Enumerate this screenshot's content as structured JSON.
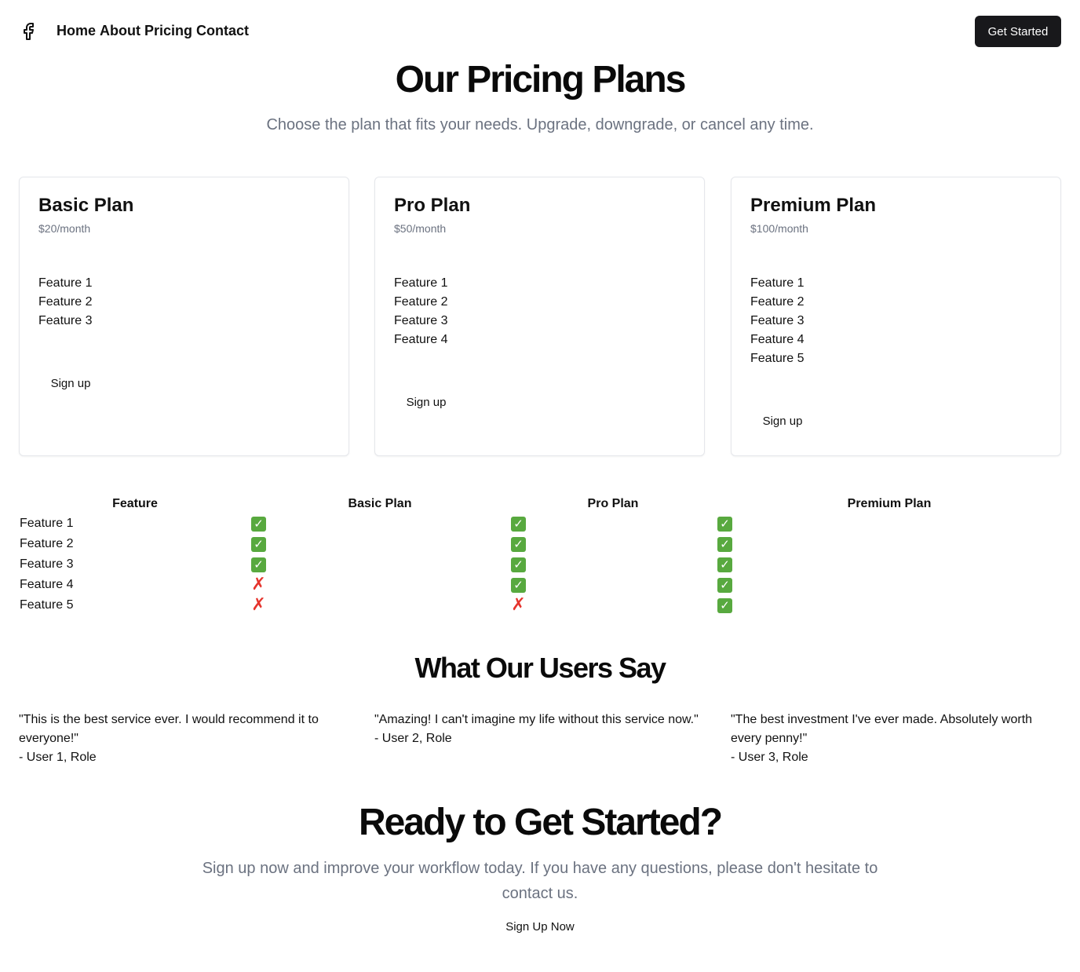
{
  "header": {
    "logo_icon": "facebook-icon",
    "nav": [
      "Home",
      "About",
      "Pricing",
      "Contact"
    ],
    "cta_label": "Get Started"
  },
  "hero": {
    "title": "Our Pricing Plans",
    "subtitle": "Choose the plan that fits your needs. Upgrade, downgrade, or cancel any time."
  },
  "plans": [
    {
      "name": "Basic Plan",
      "price": "$20/month",
      "features": [
        "Feature 1",
        "Feature 2",
        "Feature 3"
      ],
      "button": "Sign up"
    },
    {
      "name": "Pro Plan",
      "price": "$50/month",
      "features": [
        "Feature 1",
        "Feature 2",
        "Feature 3",
        "Feature 4"
      ],
      "button": "Sign up"
    },
    {
      "name": "Premium Plan",
      "price": "$100/month",
      "features": [
        "Feature 1",
        "Feature 2",
        "Feature 3",
        "Feature 4",
        "Feature 5"
      ],
      "button": "Sign up"
    }
  ],
  "comparison": {
    "headers": [
      "Feature",
      "Basic Plan",
      "Pro Plan",
      "Premium Plan"
    ],
    "rows": [
      {
        "feature": "Feature 1",
        "basic": "✓",
        "pro": "✓",
        "premium": "✓"
      },
      {
        "feature": "Feature 2",
        "basic": "✓",
        "pro": "✓",
        "premium": "✓"
      },
      {
        "feature": "Feature 3",
        "basic": "✓",
        "pro": "✓",
        "premium": "✓"
      },
      {
        "feature": "Feature 4",
        "basic": "✗",
        "pro": "✓",
        "premium": "✓"
      },
      {
        "feature": "Feature 5",
        "basic": "✗",
        "pro": "✗",
        "premium": "✓"
      }
    ],
    "colors": {
      "check_bg": "#58a93f",
      "cross": "#e5342d"
    }
  },
  "testimonials": {
    "title": "What Our Users Say",
    "items": [
      {
        "quote": "\"This is the best service ever. I would recommend it to everyone!\"",
        "author": "- User 1, Role"
      },
      {
        "quote": "\"Amazing! I can't imagine my life without this service now.\"",
        "author": "- User 2, Role"
      },
      {
        "quote": "\"The best investment I've ever made. Absolutely worth every penny!\"",
        "author": "- User 3, Role"
      }
    ]
  },
  "final_cta": {
    "title": "Ready to Get Started?",
    "subtitle": "Sign up now and improve your workflow today. If you have any questions, please don't hesitate to contact us.",
    "button": "Sign Up Now"
  }
}
